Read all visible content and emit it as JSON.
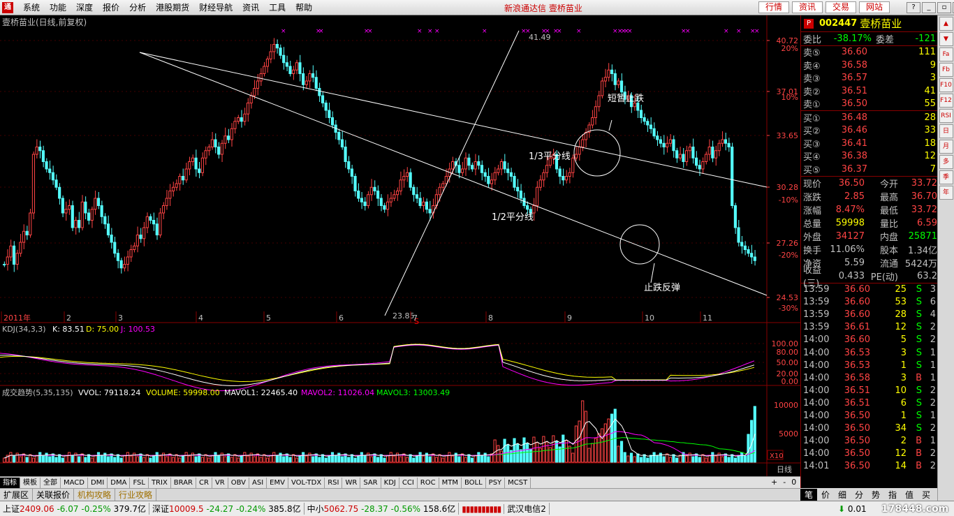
{
  "menubar": {
    "logo": "通",
    "items": [
      "系统",
      "功能",
      "深度",
      "报价",
      "分析",
      "港股期货",
      "财经导航",
      "资讯",
      "工具",
      "帮助"
    ],
    "center_title": "新浪通达信  壹桥苗业",
    "buttons": [
      "行情",
      "资讯",
      "交易",
      "网站"
    ]
  },
  "chart": {
    "title": "壹桥苗业(日线,前复权)",
    "price_axis": [
      "40.72",
      "37.01",
      "33.65",
      "30.28",
      "27.26",
      "24.53"
    ],
    "pct_axis": [
      "20%",
      "10%",
      "-10%",
      "-20%",
      "-30%"
    ],
    "month_labels": [
      "2011年",
      "2",
      "3",
      "4",
      "5",
      "6",
      "7",
      "8",
      "9",
      "10",
      "11"
    ],
    "annotations": {
      "high": "41.49",
      "low": "23.85",
      "line_third": "1/3平分线",
      "line_half": "1/2平分线",
      "short_stop": "短暂止跌",
      "stop_rebound": "止跌反弹",
      "s_marker": "S"
    }
  },
  "kdj": {
    "header": "KDJ(34,3,3)",
    "k": "K: 83.51",
    "d": "D: 75.00",
    "j": "J: 100.53",
    "axis": [
      "100.00",
      "80.00",
      "50.00",
      "20.00",
      "0.00"
    ]
  },
  "volume": {
    "header": "成交趋势(5,35,135)",
    "vvol": "VVOL: 79118.24",
    "vol": "VOLUME: 59998.00",
    "mavol1": "MAVOL1: 22465.40",
    "mavol2": "MAVOL2: 11026.04",
    "mavol3": "MAVOL3: 13003.49",
    "axis": [
      "10000",
      "5000",
      "X10"
    ]
  },
  "period_label": "日线",
  "stock": {
    "marker": "P",
    "code": "002447",
    "name": "壹桥苗业",
    "weibi_label": "委比",
    "weibi": "-38.17%",
    "weicha_label": "委差",
    "weicha": "-121",
    "sells": [
      {
        "label": "卖⑤",
        "price": "36.60",
        "qty": "111"
      },
      {
        "label": "卖④",
        "price": "36.58",
        "qty": "9"
      },
      {
        "label": "卖③",
        "price": "36.57",
        "qty": "3"
      },
      {
        "label": "卖②",
        "price": "36.51",
        "qty": "41"
      },
      {
        "label": "卖①",
        "price": "36.50",
        "qty": "55"
      }
    ],
    "buys": [
      {
        "label": "买①",
        "price": "36.48",
        "qty": "28"
      },
      {
        "label": "买②",
        "price": "36.46",
        "qty": "33"
      },
      {
        "label": "买③",
        "price": "36.41",
        "qty": "18"
      },
      {
        "label": "买④",
        "price": "36.38",
        "qty": "12"
      },
      {
        "label": "买⑤",
        "price": "36.37",
        "qty": "7"
      }
    ],
    "stats": [
      {
        "a": "现价",
        "b": "36.50",
        "c": "今开",
        "d": "33.72",
        "bc": "#f44",
        "dc": "#f44"
      },
      {
        "a": "涨跌",
        "b": "2.85",
        "c": "最高",
        "d": "36.70",
        "bc": "#f44",
        "dc": "#f44"
      },
      {
        "a": "涨幅",
        "b": "8.47%",
        "c": "最低",
        "d": "33.72",
        "bc": "#f44",
        "dc": "#f44"
      },
      {
        "a": "总量",
        "b": "59998",
        "c": "量比",
        "d": "6.59",
        "bc": "#ff0",
        "dc": "#f44"
      },
      {
        "a": "外盘",
        "b": "34127",
        "c": "内盘",
        "d": "25871",
        "bc": "#f44",
        "dc": "#0f0"
      },
      {
        "a": "换手",
        "b": "11.06%",
        "c": "股本",
        "d": "1.34亿",
        "bc": "#c0c0c0",
        "dc": "#c0c0c0"
      },
      {
        "a": "净资",
        "b": "5.59",
        "c": "流通",
        "d": "5424万",
        "bc": "#c0c0c0",
        "dc": "#c0c0c0"
      },
      {
        "a": "收益(三)",
        "b": "0.433",
        "c": "PE(动)",
        "d": "63.2",
        "bc": "#c0c0c0",
        "dc": "#c0c0c0"
      }
    ],
    "trades": [
      {
        "t": "13:59",
        "p": "36.60",
        "v": "25",
        "bs": "S",
        "n": "3"
      },
      {
        "t": "13:59",
        "p": "36.60",
        "v": "53",
        "bs": "S",
        "n": "6"
      },
      {
        "t": "13:59",
        "p": "36.60",
        "v": "28",
        "bs": "S",
        "n": "4"
      },
      {
        "t": "13:59",
        "p": "36.61",
        "v": "12",
        "bs": "S",
        "n": "2"
      },
      {
        "t": "14:00",
        "p": "36.60",
        "v": "5",
        "bs": "S",
        "n": "2"
      },
      {
        "t": "14:00",
        "p": "36.53",
        "v": "3",
        "bs": "S",
        "n": "1"
      },
      {
        "t": "14:00",
        "p": "36.53",
        "v": "1",
        "bs": "S",
        "n": "1"
      },
      {
        "t": "14:00",
        "p": "36.58",
        "v": "3",
        "bs": "B",
        "n": "1"
      },
      {
        "t": "14:00",
        "p": "36.51",
        "v": "10",
        "bs": "S",
        "n": "2"
      },
      {
        "t": "14:00",
        "p": "36.51",
        "v": "6",
        "bs": "S",
        "n": "2"
      },
      {
        "t": "14:00",
        "p": "36.50",
        "v": "1",
        "bs": "S",
        "n": "1"
      },
      {
        "t": "14:00",
        "p": "36.50",
        "v": "34",
        "bs": "S",
        "n": "2"
      },
      {
        "t": "14:00",
        "p": "36.50",
        "v": "2",
        "bs": "B",
        "n": "1"
      },
      {
        "t": "14:00",
        "p": "36.50",
        "v": "12",
        "bs": "B",
        "n": "2"
      },
      {
        "t": "14:01",
        "p": "36.50",
        "v": "14",
        "bs": "B",
        "n": "2"
      }
    ]
  },
  "righttools": [
    "▲",
    "▼",
    "Fa",
    "Fb",
    "F10",
    "F12",
    "RSI",
    "日",
    "月",
    "多",
    "季",
    "年"
  ],
  "indicator_tabs": [
    "指标",
    "模板",
    "全部",
    "MACD",
    "DMI",
    "DMA",
    "FSL",
    "TRIX",
    "BRAR",
    "CR",
    "VR",
    "OBV",
    "ASI",
    "EMV",
    "VOL-TDX",
    "RSI",
    "WR",
    "SAR",
    "KDJ",
    "CCI",
    "ROC",
    "MTM",
    "BOLL",
    "PSY",
    "MCST"
  ],
  "ind_ctrl": [
    "+",
    "-",
    "0"
  ],
  "ext_tabs": [
    "扩展区",
    "关联报价",
    "机构攻略",
    "行业攻略"
  ],
  "rp_tabs": [
    "笔",
    "价",
    "细",
    "分",
    "势",
    "指",
    "值",
    "买"
  ],
  "status": {
    "sh_label": "上证",
    "sh_val": "2409.06",
    "sh_chg": "-6.07",
    "sh_pct": "-0.25%",
    "sh_amt": "379.7亿",
    "sz_label": "深证",
    "sz_val": "10009.5",
    "sz_chg": "-24.27",
    "sz_pct": "-0.24%",
    "sz_amt": "385.8亿",
    "zx_label": "中小",
    "zx_val": "5062.75",
    "zx_chg": "-28.37",
    "zx_pct": "-0.56%",
    "zx_amt": "158.6亿",
    "news": "武汉电信2",
    "right": "0.01",
    "watermark": "178448.com"
  }
}
